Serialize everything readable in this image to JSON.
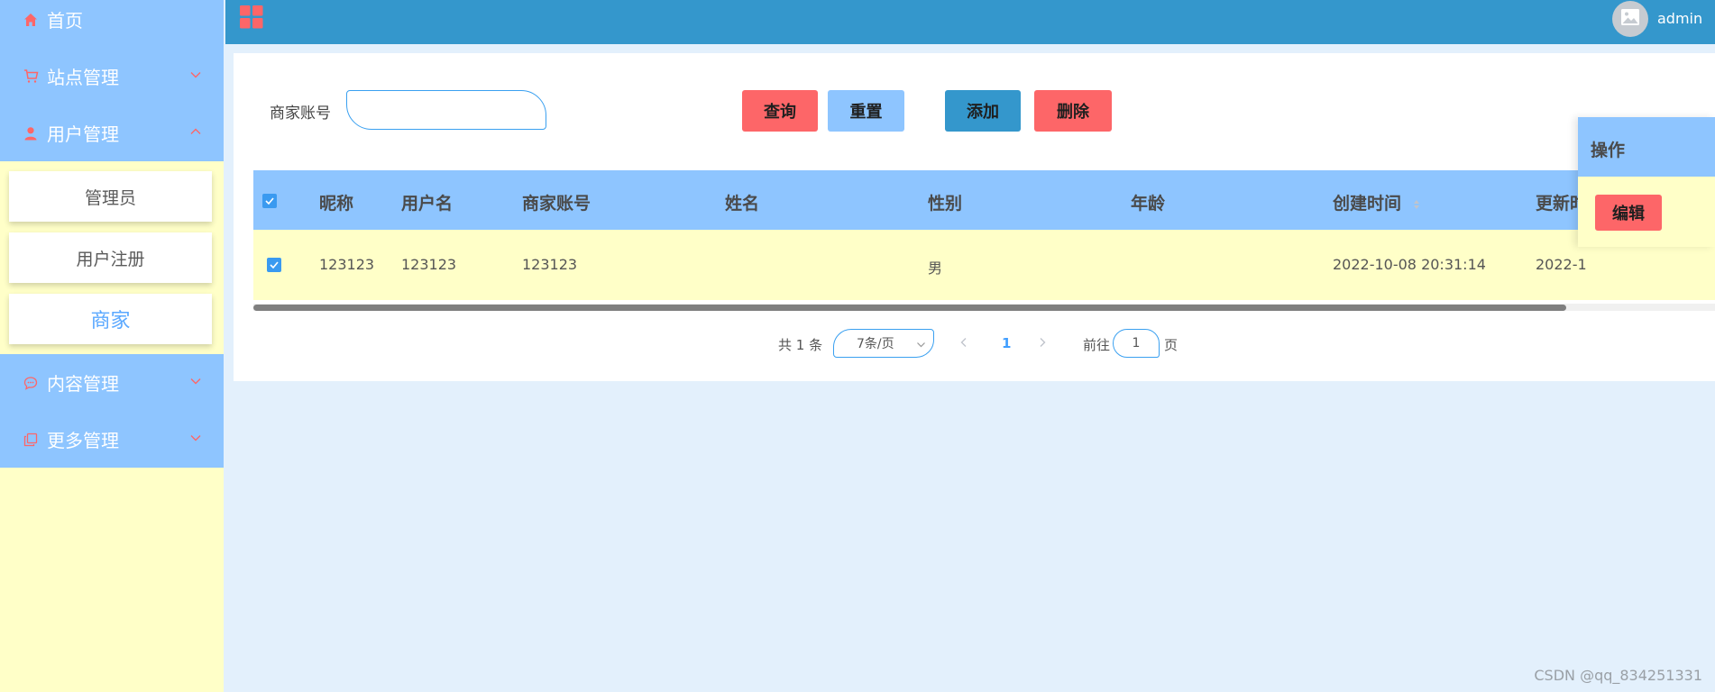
{
  "sidebar": {
    "items": [
      {
        "label": "首页",
        "icon": "home-icon"
      },
      {
        "label": "站点管理",
        "icon": "cart-icon"
      },
      {
        "label": "用户管理",
        "icon": "user-icon"
      },
      {
        "label": "内容管理",
        "icon": "chat-icon"
      },
      {
        "label": "更多管理",
        "icon": "copy-icon"
      }
    ],
    "user_submenu": [
      {
        "label": "管理员"
      },
      {
        "label": "用户注册"
      },
      {
        "label": "商家",
        "active": true
      }
    ]
  },
  "header": {
    "menu_icon": "grid-icon",
    "avatar_icon": "image-icon",
    "username": "admin"
  },
  "search": {
    "label": "商家账号",
    "value": "",
    "placeholder": ""
  },
  "buttons": {
    "query": "查询",
    "reset": "重置",
    "add": "添加",
    "delete": "删除"
  },
  "table": {
    "columns": [
      "昵称",
      "用户名",
      "商家账号",
      "姓名",
      "性别",
      "年龄",
      "创建时间",
      "更新时",
      "操作"
    ],
    "rows": [
      {
        "nickname": "123123",
        "username": "123123",
        "merchant_account": "123123",
        "name": "",
        "gender": "男",
        "age": "",
        "created_at": "2022-10-08 20:31:14",
        "updated_at": "2022-1",
        "action": "编辑"
      }
    ]
  },
  "pagination": {
    "total": "共 1 条",
    "page_size": "7条/页",
    "current_page": "1",
    "goto_prefix": "前往",
    "goto_value": "1",
    "goto_suffix": "页"
  },
  "watermark": "CSDN @qq_834251331",
  "colors": {
    "sidebar_menu": "#8ec5ff",
    "sidebar_bg": "#ffffc8",
    "header": "#3497cc",
    "page_bg": "#e3f0fc",
    "danger": "#fd6668",
    "accent_blue": "#3a9af0",
    "row_highlight": "#ffffc8"
  }
}
